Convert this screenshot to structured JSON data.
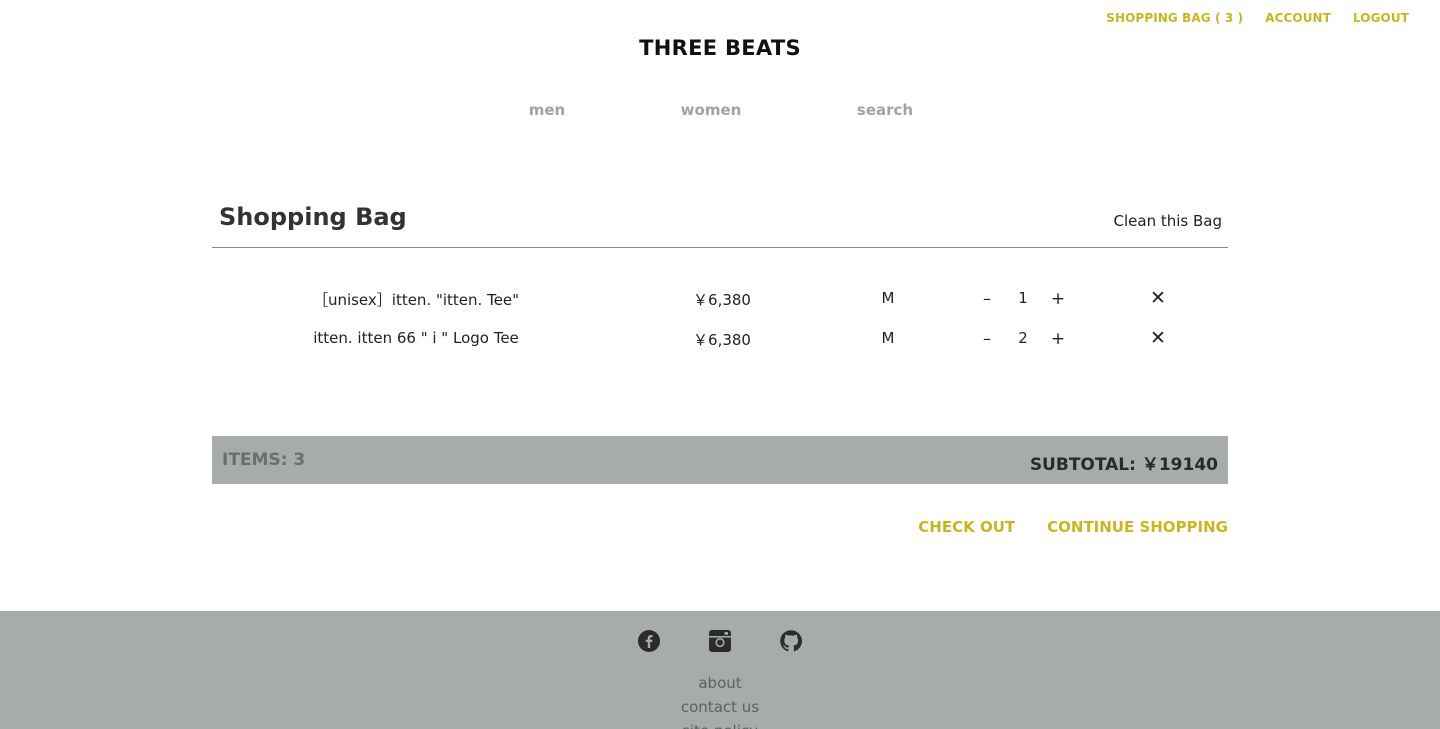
{
  "user_nav": {
    "shopping_bag": "SHOPPING BAG ( 3 )",
    "account": "ACCOUNT",
    "logout": "LOGOUT"
  },
  "brand": "THREE BEATS",
  "main_nav": {
    "men": "men",
    "women": "women",
    "search": "search"
  },
  "bag": {
    "title": "Shopping Bag",
    "clean_label": "Clean this Bag",
    "items": [
      {
        "name": "［unisex］itten. \"itten. Tee\"",
        "price": "￥6,380",
        "size": "M",
        "minus": "–",
        "qty": "1",
        "plus": "+",
        "remove": "✕"
      },
      {
        "name": "itten. itten 66 \" i \" Logo Tee",
        "price": "￥6,380",
        "size": "M",
        "minus": "–",
        "qty": "2",
        "plus": "+",
        "remove": "✕"
      }
    ]
  },
  "summary": {
    "items": "ITEMS: 3",
    "subtotal": "SUBTOTAL:  ￥19140"
  },
  "actions": {
    "checkout": "CHECK OUT",
    "continue": "CONTINUE SHOPPING"
  },
  "footer": {
    "social_icons": [
      "facebook-icon",
      "instagram-icon",
      "github-icon"
    ],
    "links": [
      "about",
      "contact us",
      "site policy"
    ]
  },
  "colors": {
    "accent": "#c9b51f",
    "summary_bg": "#a8abac",
    "footer_bg": "#a8abac",
    "nav_text": "#a2a2a2"
  }
}
